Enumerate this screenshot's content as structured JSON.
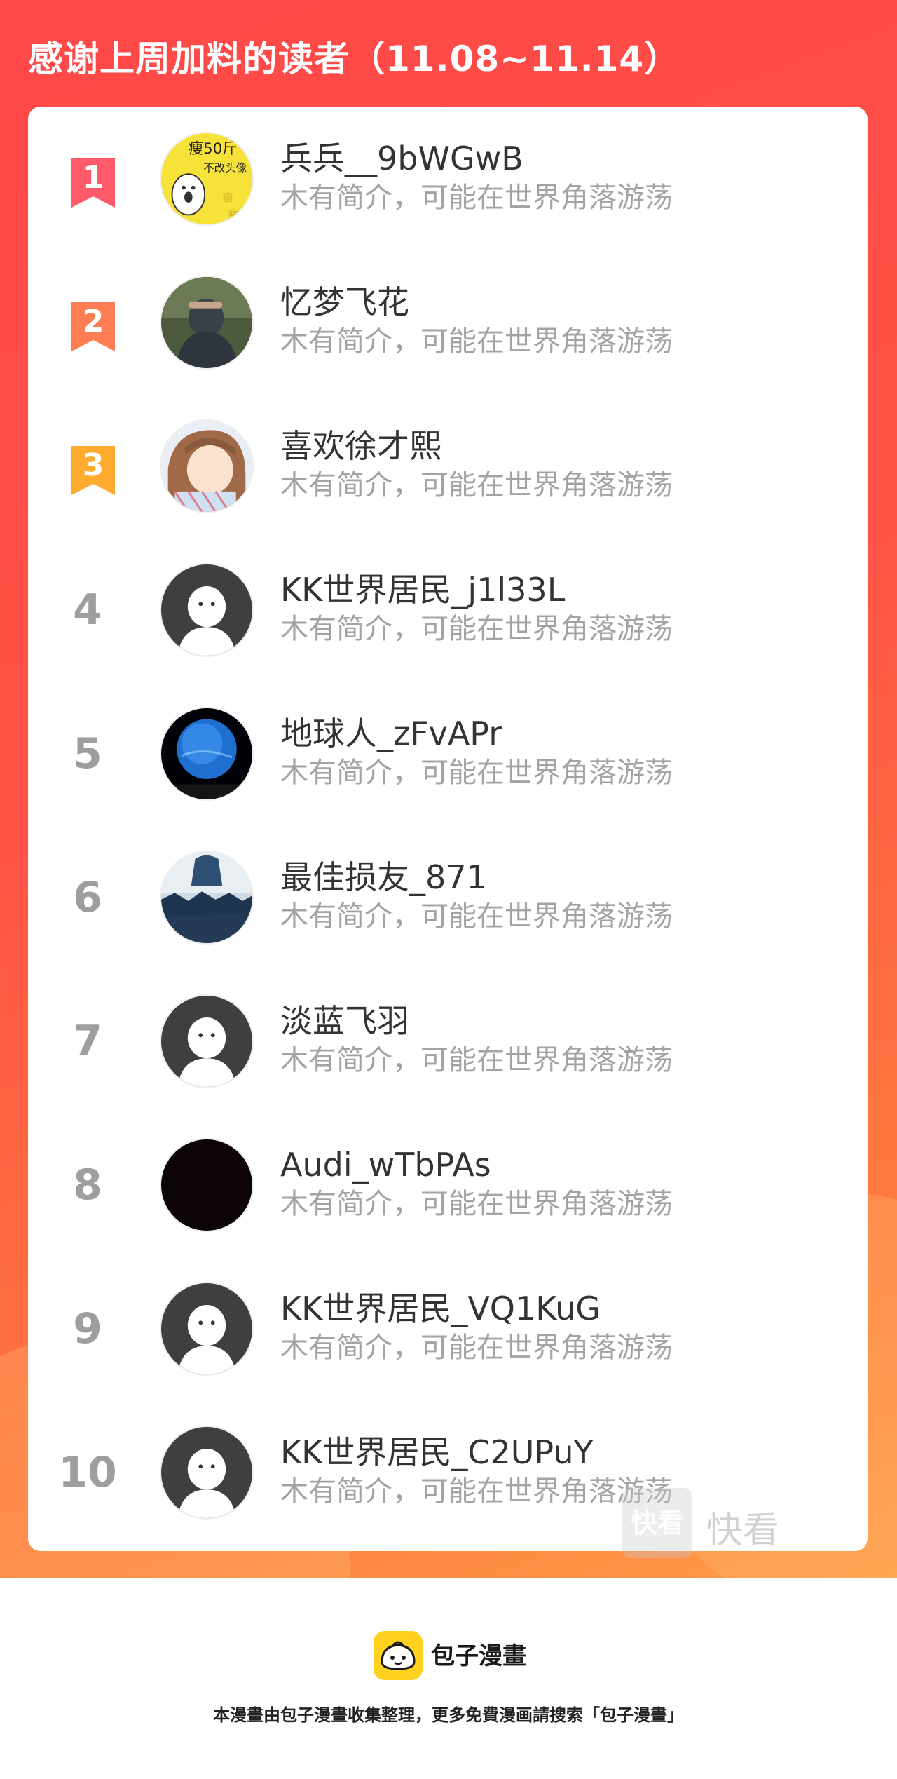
{
  "header": {
    "title": "感谢上周加料的读者（11.08~11.14）"
  },
  "colors": {
    "banner_start": "#ff4848",
    "banner_end": "#ff9c4a",
    "rank1": "#ff5a6a",
    "rank2": "#ff7d55",
    "rank3": "#ffab2e",
    "rank_other": "#9e9e9e",
    "name_text": "#333333",
    "bio_text": "#a3a3a3"
  },
  "readers": [
    {
      "rank": "1",
      "name": "兵兵__9bWGwB",
      "bio": "木有简介，可能在世界角落游荡",
      "avatar": "meme-avatar"
    },
    {
      "rank": "2",
      "name": "忆梦飞花",
      "bio": "木有简介，可能在世界角落游荡",
      "avatar": "photo-avatar"
    },
    {
      "rank": "3",
      "name": "喜欢徐才熙",
      "bio": "木有简介，可能在世界角落游荡",
      "avatar": "anime-avatar"
    },
    {
      "rank": "4",
      "name": "KK世界居民_j1l33L",
      "bio": "木有简介，可能在世界角落游荡",
      "avatar": "default-avatar"
    },
    {
      "rank": "5",
      "name": "地球人_zFvAPr",
      "bio": "木有简介，可能在世界角落游荡",
      "avatar": "planet-avatar"
    },
    {
      "rank": "6",
      "name": "最佳损友_871",
      "bio": "木有简介，可能在世界角落游荡",
      "avatar": "crowd-avatar"
    },
    {
      "rank": "7",
      "name": "淡蓝飞羽",
      "bio": "木有简介，可能在世界角落游荡",
      "avatar": "default-avatar"
    },
    {
      "rank": "8",
      "name": "Audi_wTbPAs",
      "bio": "木有简介，可能在世界角落游荡",
      "avatar": "black-avatar"
    },
    {
      "rank": "9",
      "name": "KK世界居民_VQ1KuG",
      "bio": "木有简介，可能在世界角落游荡",
      "avatar": "default-avatar"
    },
    {
      "rank": "10",
      "name": "KK世界居民_C2UPuY",
      "bio": "木有简介，可能在世界角落游荡",
      "avatar": "default-avatar"
    }
  ],
  "watermark": {
    "box": "快看",
    "text": "快看"
  },
  "footer": {
    "brand_name": "包子漫畫",
    "note": "本漫畫由包子漫畫收集整理，更多免費漫画請搜索「包子漫畫」"
  }
}
